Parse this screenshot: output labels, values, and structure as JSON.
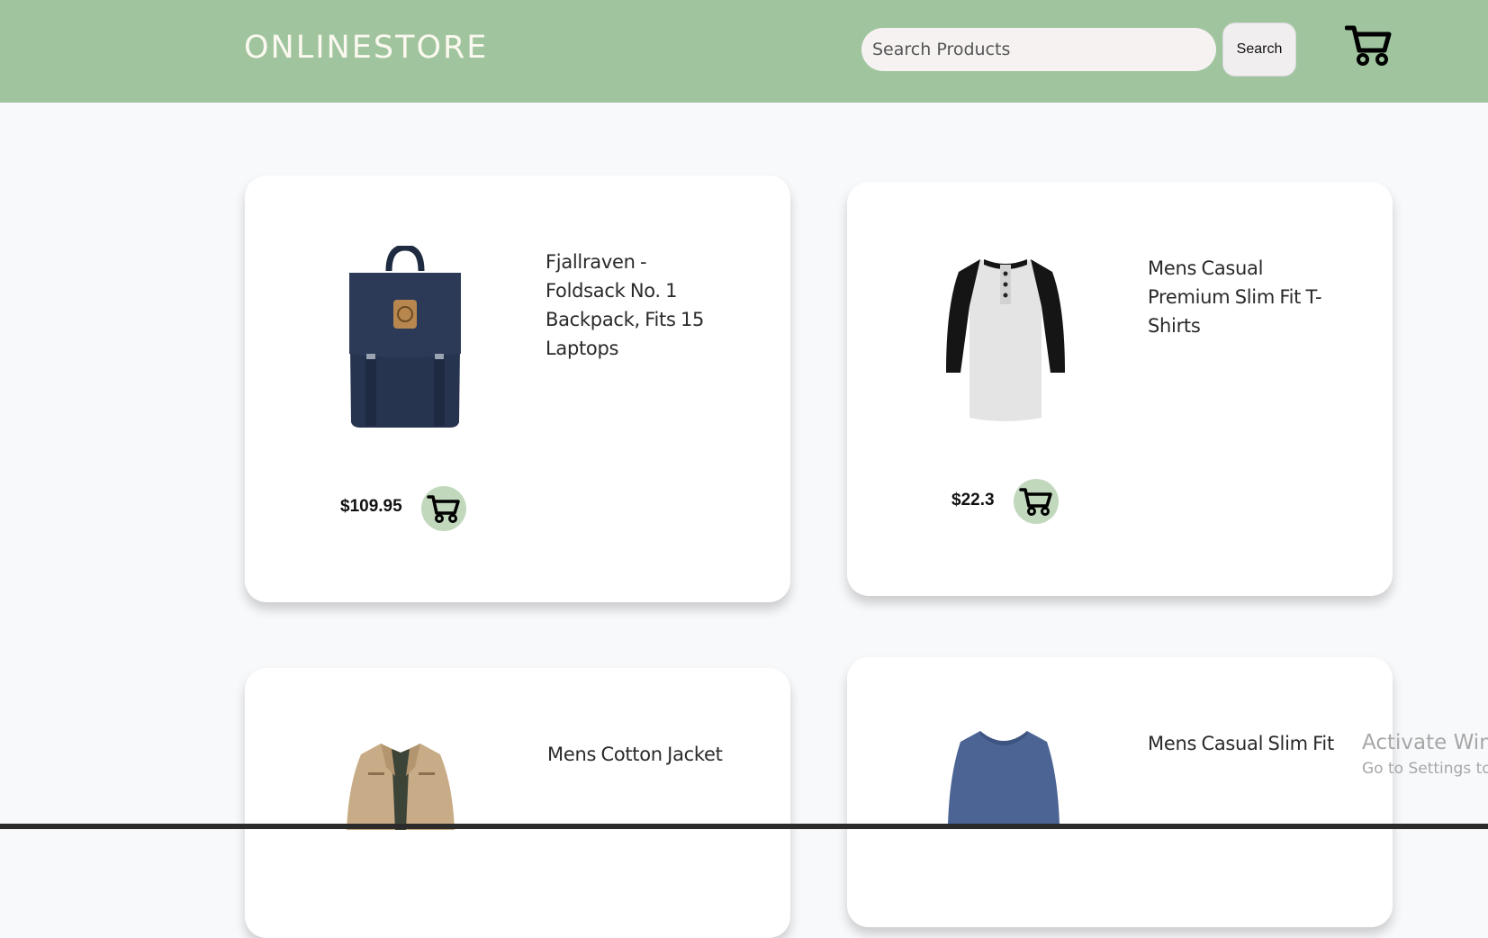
{
  "header": {
    "brand": "ONLINESTORE",
    "search_placeholder": "Search Products",
    "search_button": "Search",
    "background_color": "#a0c59e",
    "cart_icon": "cart-icon"
  },
  "products": [
    {
      "title": "Fjallraven - Foldsack No. 1 Backpack, Fits 15 Laptops",
      "price": "$109.95",
      "image": "backpack-image"
    },
    {
      "title": "Mens Casual Premium Slim Fit T-Shirts",
      "price": "$22.3",
      "image": "tshirt-image"
    },
    {
      "title": "Mens Cotton Jacket",
      "price": "",
      "image": "jacket-image"
    },
    {
      "title": "Mens Casual Slim Fit",
      "price": "",
      "image": "sweater-image"
    }
  ],
  "watermark": {
    "line1": "Activate Win",
    "line2": "Go to Settings to"
  },
  "colors": {
    "accent": "#a0c59e",
    "cart_button": "#c1d8bd"
  }
}
